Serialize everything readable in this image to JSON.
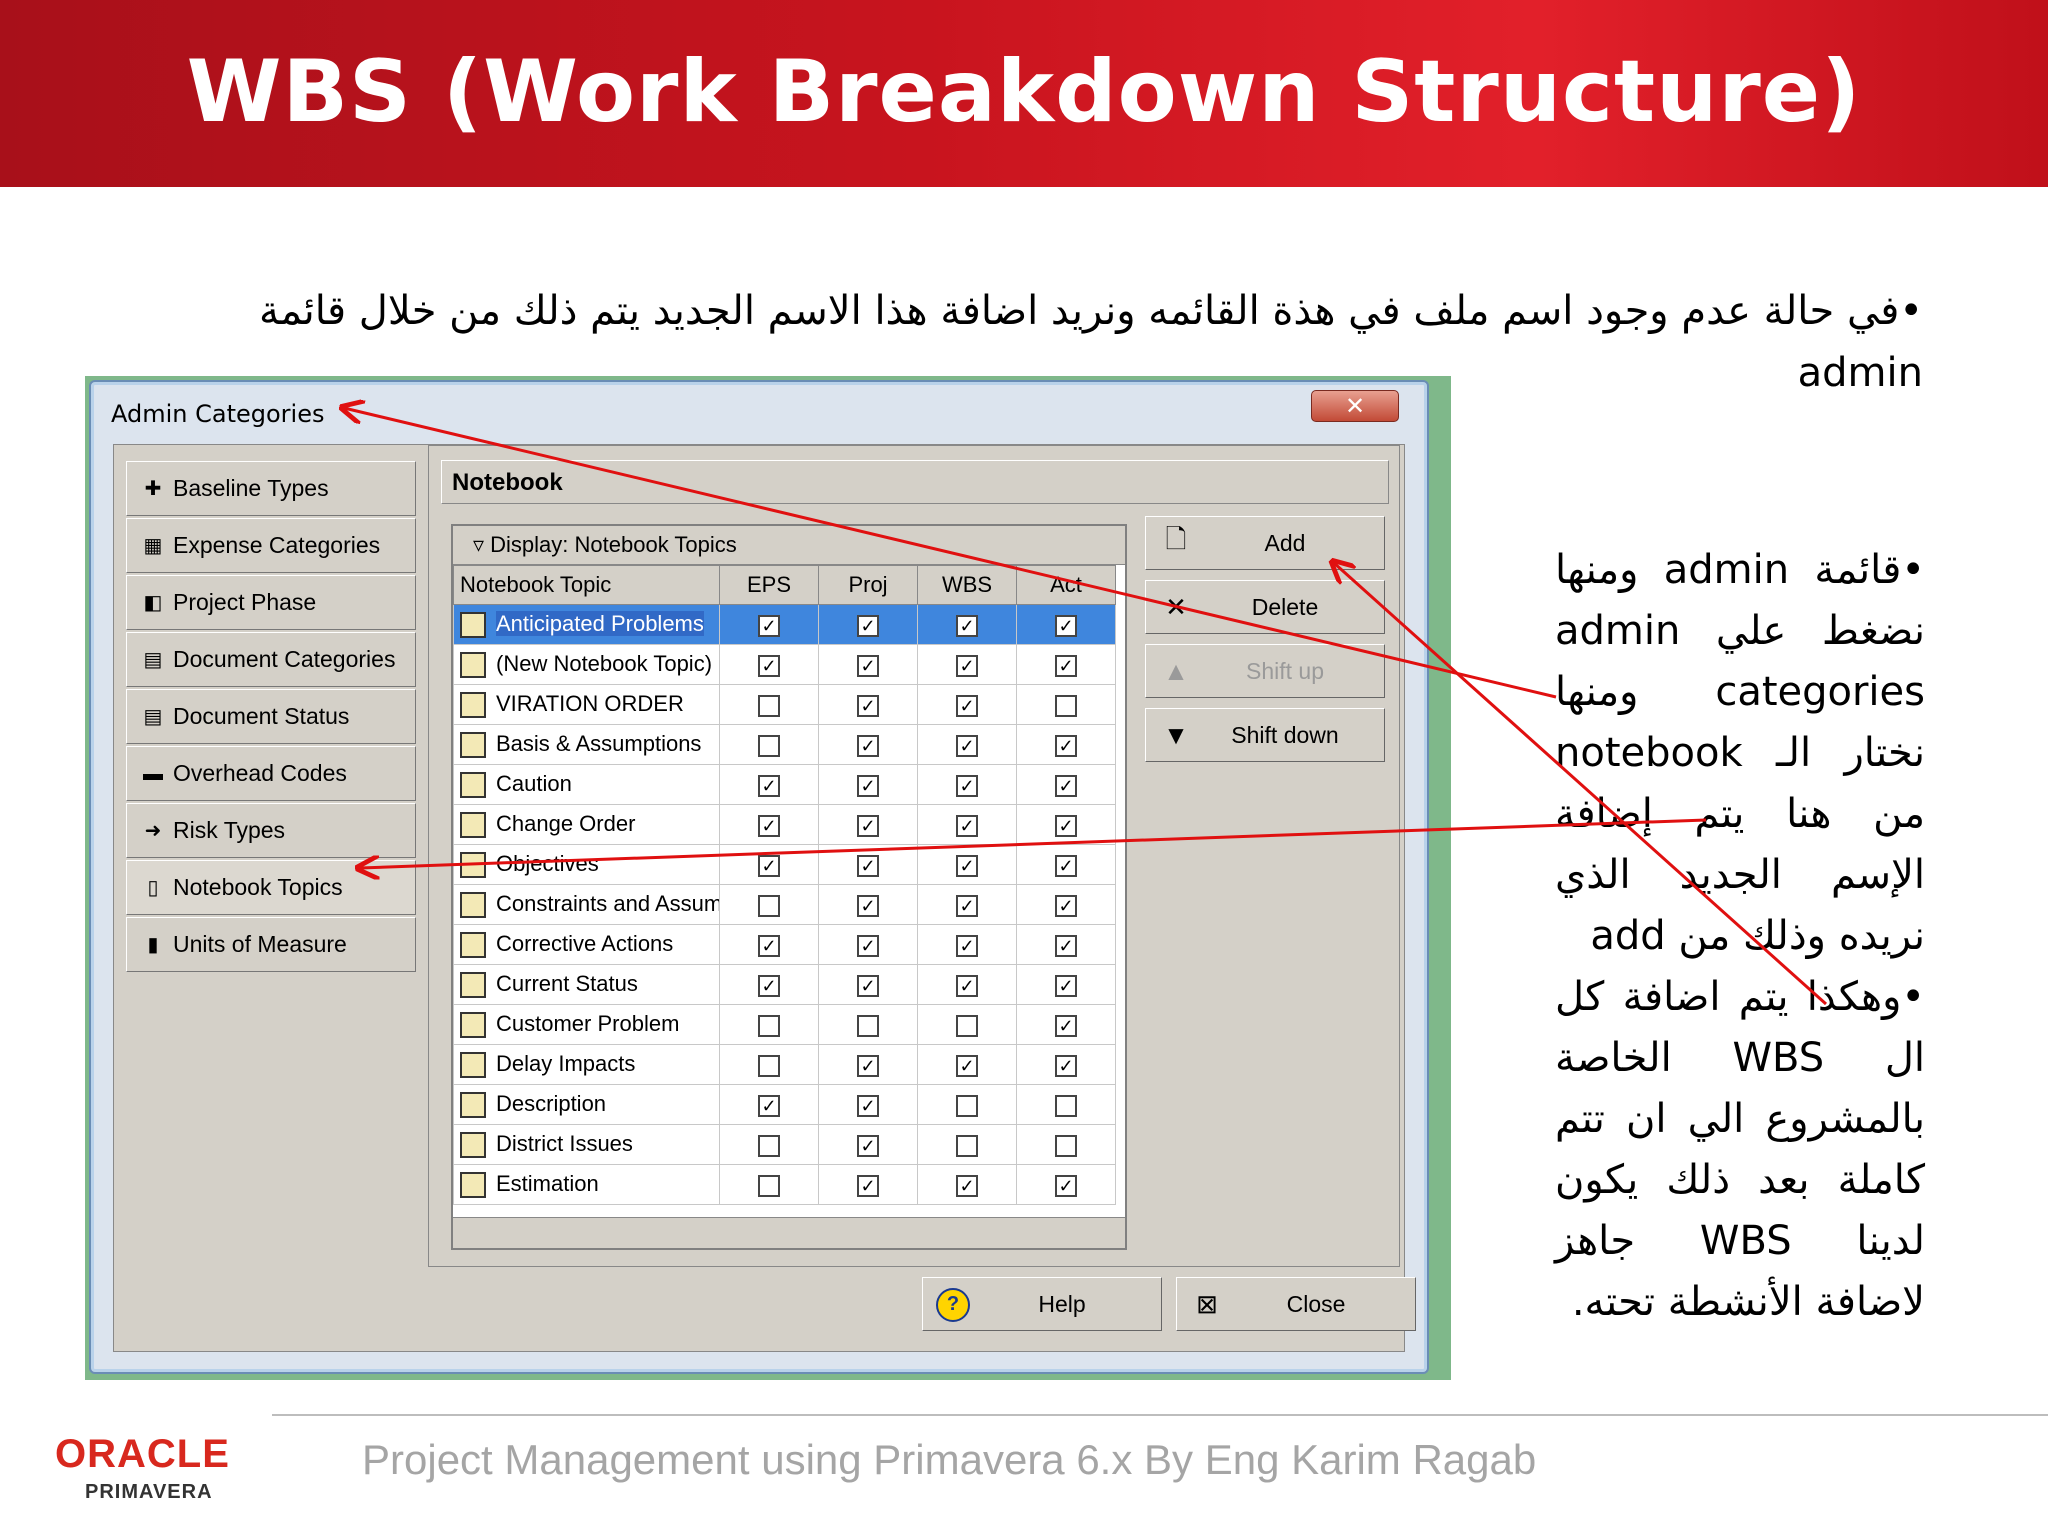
{
  "slide": {
    "title": "WBS (Work Breakdown Structure)",
    "intro_ar": "•في حالة عدم وجود اسم ملف في هذة القائمه ونريد اضافة هذا الاسم الجديد يتم ذلك من خلال قائمة",
    "intro_en": "admin",
    "side_paragraphs": [
      "•قائمة admin ومنها نضغط علي admin categories ومنها نختار الـ notebook من هنا يتم إضافة الإسم الجديد الذي نريده وذلك من add",
      "•وهكذا يتم اضافة كل ال WBS الخاصة بالمشروع الي ان تتم كاملة بعد ذلك يكون لدينا WBS جاهز لاضافة الأنشطة تحته."
    ],
    "footer_text": "Project Management using Primavera 6.x By Eng Karim Ragab",
    "logo_text_1": "ORACLE",
    "logo_text_2": "PRIMAVERA",
    "header_color": "#c8141e",
    "arrow_color": "#e01010"
  },
  "dialog": {
    "title": "Admin Categories",
    "close_glyph": "✕",
    "nav_items": [
      {
        "label": "Baseline Types",
        "icon": "baseline-icon",
        "glyph": "✚"
      },
      {
        "label": "Expense Categories",
        "icon": "expense-icon",
        "glyph": "▦"
      },
      {
        "label": "Project Phase",
        "icon": "phase-icon",
        "glyph": "◧"
      },
      {
        "label": "Document Categories",
        "icon": "document-icon",
        "glyph": "▤"
      },
      {
        "label": "Document Status",
        "icon": "document-status-icon",
        "glyph": "▤"
      },
      {
        "label": "Overhead Codes",
        "icon": "overhead-icon",
        "glyph": "▬"
      },
      {
        "label": "Risk Types",
        "icon": "risk-icon",
        "glyph": "➜"
      },
      {
        "label": "Notebook Topics",
        "icon": "notebook-icon",
        "glyph": "▯"
      },
      {
        "label": "Units of Measure",
        "icon": "units-icon",
        "glyph": "▮"
      }
    ],
    "panel_title": "Notebook",
    "display_label": "Display: Notebook Topics",
    "columns": [
      "Notebook Topic",
      "EPS",
      "Proj",
      "WBS",
      "Act"
    ],
    "rows": [
      {
        "name": "Anticipated Problems",
        "eps": true,
        "proj": true,
        "wbs": true,
        "act": true,
        "selected": true
      },
      {
        "name": "(New Notebook Topic)",
        "eps": true,
        "proj": true,
        "wbs": true,
        "act": true
      },
      {
        "name": "VIRATION ORDER",
        "eps": false,
        "proj": true,
        "wbs": true,
        "act": false
      },
      {
        "name": "Basis & Assumptions",
        "eps": false,
        "proj": true,
        "wbs": true,
        "act": true
      },
      {
        "name": "Caution",
        "eps": true,
        "proj": true,
        "wbs": true,
        "act": true
      },
      {
        "name": "Change Order",
        "eps": true,
        "proj": true,
        "wbs": true,
        "act": true
      },
      {
        "name": "Objectives",
        "eps": true,
        "proj": true,
        "wbs": true,
        "act": true
      },
      {
        "name": "Constraints and Assumptions",
        "eps": false,
        "proj": true,
        "wbs": true,
        "act": true
      },
      {
        "name": "Corrective Actions",
        "eps": true,
        "proj": true,
        "wbs": true,
        "act": true
      },
      {
        "name": "Current Status",
        "eps": true,
        "proj": true,
        "wbs": true,
        "act": true
      },
      {
        "name": "Customer Problem",
        "eps": false,
        "proj": false,
        "wbs": false,
        "act": true
      },
      {
        "name": "Delay Impacts",
        "eps": false,
        "proj": true,
        "wbs": true,
        "act": true
      },
      {
        "name": "Description",
        "eps": true,
        "proj": true,
        "wbs": false,
        "act": false
      },
      {
        "name": "District Issues",
        "eps": false,
        "proj": true,
        "wbs": false,
        "act": false
      },
      {
        "name": "Estimation",
        "eps": false,
        "proj": true,
        "wbs": true,
        "act": true
      }
    ],
    "buttons": {
      "add": "Add",
      "delete": "Delete",
      "shift_up": "Shift up",
      "shift_down": "Shift down",
      "help": "Help",
      "close": "Close"
    },
    "button_glyphs": {
      "add": "🗋",
      "delete": "✕",
      "shift_up": "▲",
      "shift_down": "▼",
      "help": "?",
      "close": "⊠"
    }
  }
}
